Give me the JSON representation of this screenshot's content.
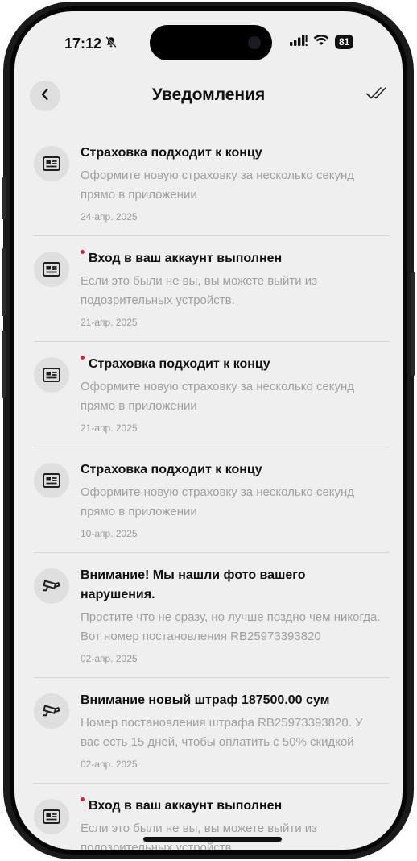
{
  "status_bar": {
    "time": "17:12",
    "battery": "81"
  },
  "header": {
    "title": "Уведомления"
  },
  "notifications": [
    {
      "title": "Страховка подходит к концу",
      "desc": [
        "Оформите новую страховку за несколько секунд",
        "прямо в приложении"
      ],
      "date": "24-апр. 2025",
      "unread": false,
      "icon": "news-icon"
    },
    {
      "title": "Вход в ваш аккаунт выполнен",
      "desc": [
        "Если это были не вы, вы можете выйти из",
        "подозрительных устройств."
      ],
      "date": "21-апр. 2025",
      "unread": true,
      "icon": "news-icon"
    },
    {
      "title": "Страховка подходит к концу",
      "desc": [
        "Оформите новую страховку за несколько секунд",
        "прямо в приложении"
      ],
      "date": "21-апр. 2025",
      "unread": true,
      "icon": "news-icon"
    },
    {
      "title": "Страховка подходит к концу",
      "desc": [
        "Оформите новую страховку за несколько секунд",
        "прямо в приложении"
      ],
      "date": "10-апр. 2025",
      "unread": false,
      "icon": "news-icon"
    },
    {
      "title": [
        "Внимание! Мы нашли фото вашего",
        "нарушения."
      ],
      "desc": [
        "Простите что не сразу, но лучше поздно чем никогда.",
        "Вот номер постановления RB25973393820"
      ],
      "date": "02-апр. 2025",
      "unread": false,
      "icon": "camera-icon"
    },
    {
      "title": "Внимание новый штраф 187500.00 сум",
      "desc": [
        "Номер постановления штрафа RB25973393820. У",
        "вас есть 15 дней, чтобы оплатить с 50% скидкой"
      ],
      "date": "02-апр. 2025",
      "unread": false,
      "icon": "camera-icon"
    },
    {
      "title": "Вход в ваш аккаунт выполнен",
      "desc": [
        "Если это были не вы, вы можете выйти из",
        "подозрительных устройств."
      ],
      "date": "",
      "unread": true,
      "icon": "news-icon"
    }
  ],
  "colors": {
    "unread_dot": "#e0203a",
    "background": "#efefef",
    "text": "#111111",
    "muted": "#a0a0a0"
  }
}
